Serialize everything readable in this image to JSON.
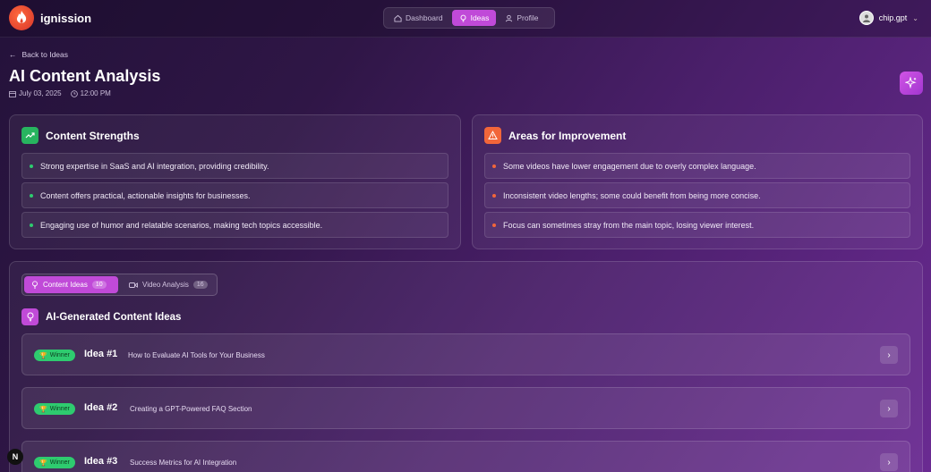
{
  "app": {
    "brand": "ignission"
  },
  "nav": {
    "dashboard": "Dashboard",
    "ideas": "Ideas",
    "profile": "Profile"
  },
  "user": {
    "name": "chip.gpt"
  },
  "header": {
    "back": "Back to Ideas",
    "title": "AI Content Analysis",
    "date": "July 03, 2025",
    "time": "12:00 PM"
  },
  "strengths": {
    "title": "Content Strengths",
    "items": [
      "Strong expertise in SaaS and AI integration, providing credibility.",
      "Content offers practical, actionable insights for businesses.",
      "Engaging use of humor and relatable scenarios, making tech topics accessible."
    ]
  },
  "improvements": {
    "title": "Areas for Improvement",
    "items": [
      "Some videos have lower engagement due to overly complex language.",
      "Inconsistent video lengths; some could benefit from being more concise.",
      "Focus can sometimes stray from the main topic, losing viewer interest."
    ]
  },
  "tabs": {
    "content_ideas": "Content Ideas",
    "content_ideas_count": "10",
    "video_analysis": "Video Analysis",
    "video_analysis_count": "16"
  },
  "ideas_section": {
    "title": "AI-Generated Content Ideas",
    "items": [
      {
        "badge": "Winner",
        "num": "Idea #1",
        "text": "How to Evaluate AI Tools for Your Business"
      },
      {
        "badge": "Winner",
        "num": "Idea #2",
        "text": "Creating a GPT-Powered FAQ Section"
      },
      {
        "badge": "Winner",
        "num": "Idea #3",
        "text": "Success Metrics for AI Integration"
      }
    ]
  },
  "colors": {
    "accent": "#c04ad8",
    "strength": "#2ecb6f",
    "improvement": "#f2663a"
  },
  "dev_badge": "N"
}
